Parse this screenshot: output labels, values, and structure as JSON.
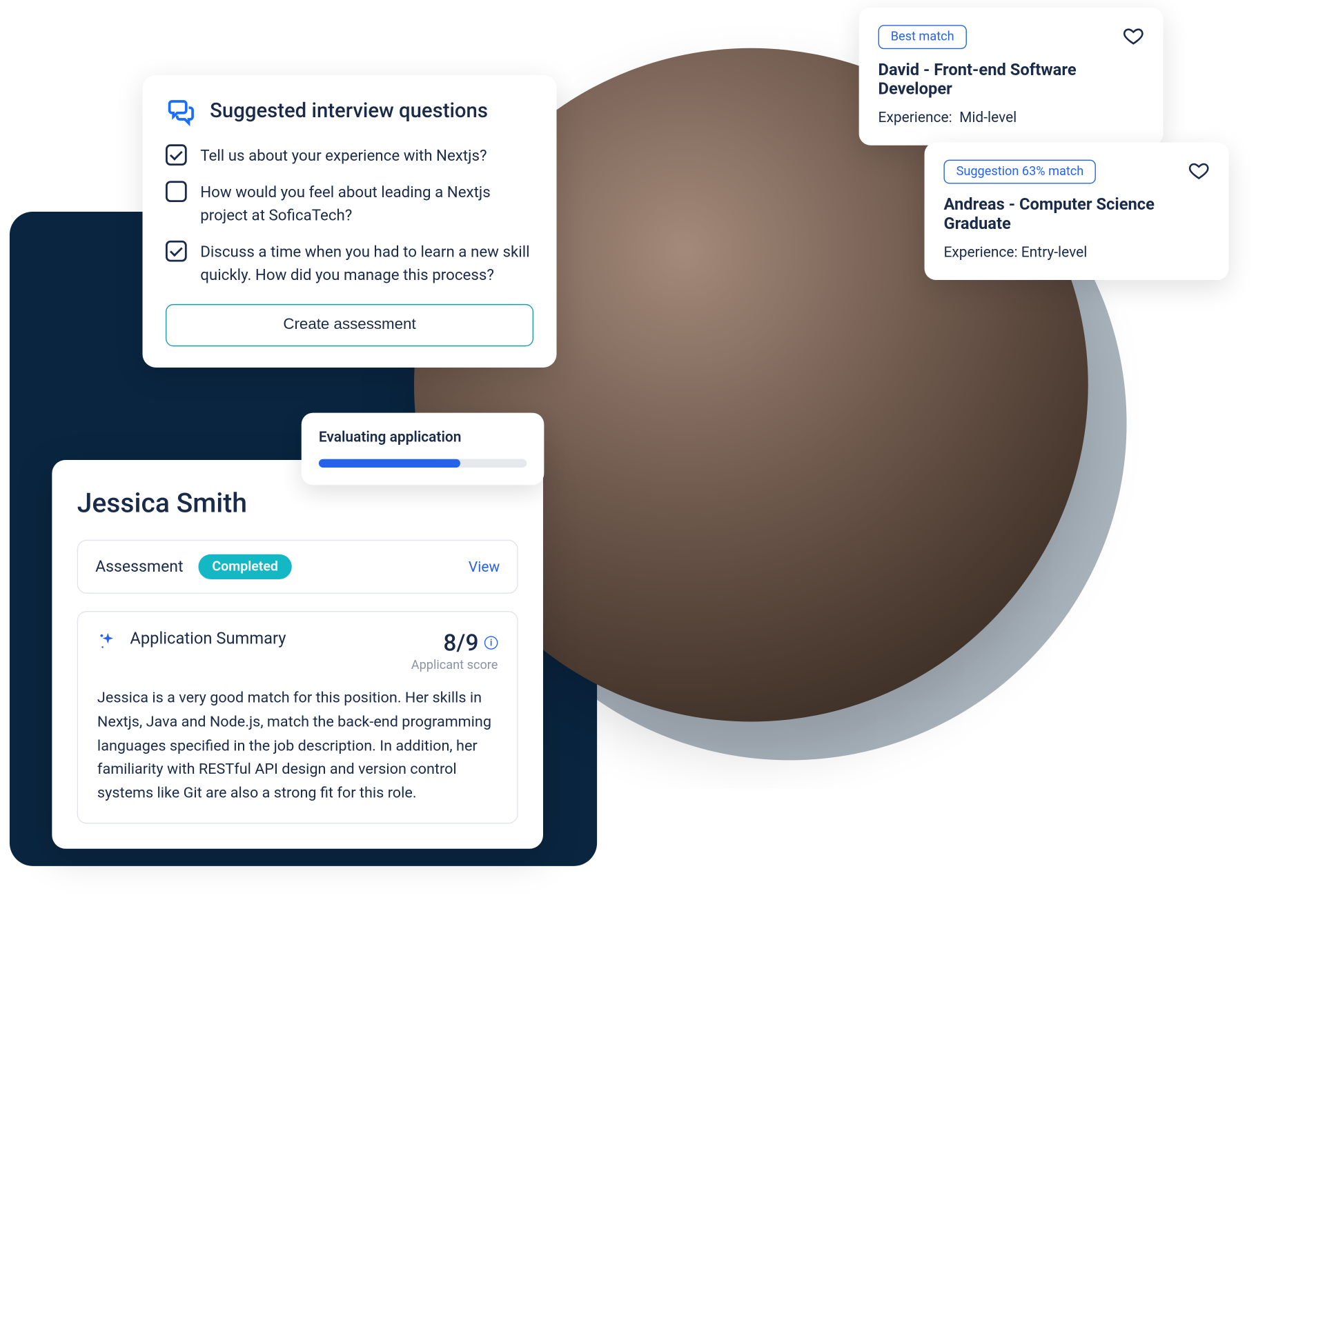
{
  "questions_card": {
    "title": "Suggested interview questions",
    "items": [
      {
        "text": "Tell us about your experience with Nextjs?",
        "checked": true
      },
      {
        "text": "How would you feel about leading a Nextjs project at SoficaTech?",
        "checked": false
      },
      {
        "text": "Discuss a time when you had to learn a new skill quickly. How did you manage this process?",
        "checked": true
      }
    ],
    "button_label": "Create assessment"
  },
  "evaluating": {
    "title": "Evaluating application",
    "progress_pct": 68
  },
  "applicant": {
    "name": "Jessica Smith",
    "assessment": {
      "label": "Assessment",
      "status": "Completed",
      "view_label": "View"
    },
    "summary": {
      "title": "Application Summary",
      "score": "8/9",
      "score_label": "Applicant score",
      "text": "Jessica is a very good match for this position. Her skills in Nextjs, Java and Node.js, match the back-end programming languages specified in the job description. In addition, her familiarity with RESTful API design and version control systems like Git are also a strong fit for this role."
    }
  },
  "matches": [
    {
      "badge": "Best match",
      "name": "David - Front-end Software Developer",
      "experience_label": "Experience:",
      "experience_value": "Mid-level"
    },
    {
      "badge": "Suggestion 63% match",
      "name": "Andreas - Computer Science Graduate",
      "experience_label": "Experience:",
      "experience_value": "Entry-level"
    }
  ]
}
